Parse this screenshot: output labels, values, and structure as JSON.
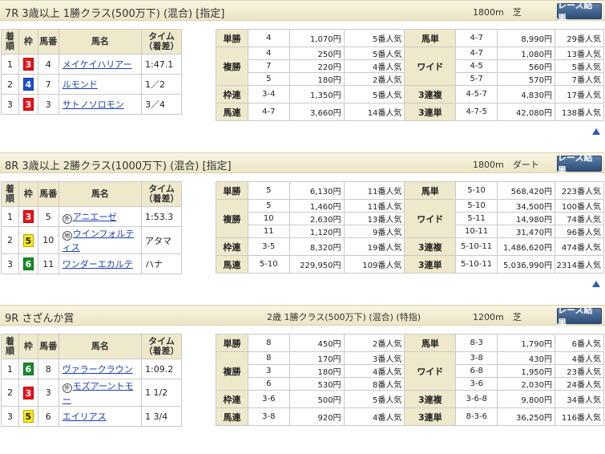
{
  "header_labels": {
    "finish_order": "着順",
    "frame": "枠",
    "horse_num": "馬番",
    "horse_name": "馬名",
    "time": "タイム（着差）",
    "result_button": "レース結果"
  },
  "colors": {
    "frame_3": "#e8141a",
    "frame_4": "#1a4fd6",
    "frame_5": "#f7e81a",
    "frame_6": "#1a8a2a",
    "header_band": "#ece5c4",
    "label_cell": "#efe9cc",
    "link": "#1a3fb0",
    "button": "#2d4d78"
  },
  "races": [
    {
      "title": "7R 3歳以上 1勝クラス(500万下) (混合) [指定]",
      "sub": "",
      "distance": "1800m　芝",
      "results": [
        {
          "pos": "1",
          "frame": "3",
          "num": "4",
          "mark": "",
          "name": "メイケイハリアー",
          "time": "1:47.1"
        },
        {
          "pos": "2",
          "frame": "4",
          "num": "7",
          "mark": "",
          "name": "ルモンド",
          "time": "1／2"
        },
        {
          "pos": "3",
          "frame": "3",
          "num": "3",
          "mark": "",
          "name": "サトノソロモン",
          "time": "3／4"
        }
      ],
      "payouts": {
        "tansho": {
          "label": "単勝",
          "combos": [
            "4"
          ],
          "amounts": [
            "1,070円"
          ],
          "pops": [
            "5番人気"
          ]
        },
        "fukusho": {
          "label": "複勝",
          "combos": [
            "4",
            "7",
            "5"
          ],
          "amounts": [
            "250円",
            "220円",
            "180円"
          ],
          "pops": [
            "5番人気",
            "4番人気",
            "2番人気"
          ]
        },
        "wakuren": {
          "label": "枠連",
          "combos": [
            "3-4"
          ],
          "amounts": [
            "1,350円"
          ],
          "pops": [
            "5番人気"
          ]
        },
        "umaren": {
          "label": "馬連",
          "combos": [
            "4-7"
          ],
          "amounts": [
            "3,660円"
          ],
          "pops": [
            "14番人気"
          ]
        },
        "umatan": {
          "label": "馬単",
          "combos": [
            "4-7"
          ],
          "amounts": [
            "8,990円"
          ],
          "pops": [
            "29番人気"
          ]
        },
        "wide": {
          "label": "ワイド",
          "combos": [
            "4-7",
            "4-5",
            "5-7"
          ],
          "amounts": [
            "1,080円",
            "560円",
            "570円"
          ],
          "pops": [
            "13番人気",
            "5番人気",
            "7番人気"
          ]
        },
        "sanrenpuku": {
          "label": "3連複",
          "combos": [
            "4-5-7"
          ],
          "amounts": [
            "4,830円"
          ],
          "pops": [
            "17番人気"
          ]
        },
        "sanrentan": {
          "label": "3連単",
          "combos": [
            "4-7-5"
          ],
          "amounts": [
            "42,080円"
          ],
          "pops": [
            "138番人気"
          ]
        }
      }
    },
    {
      "title": "8R 3歳以上 2勝クラス(1000万下) (混合) [指定]",
      "sub": "",
      "distance": "1800m　ダート",
      "results": [
        {
          "pos": "1",
          "frame": "3",
          "num": "5",
          "mark": "外",
          "name": "アニエーゼ",
          "time": "1:53.3"
        },
        {
          "pos": "2",
          "frame": "5",
          "num": "10",
          "mark": "地",
          "name": "ウインフォルティス",
          "time": "アタマ"
        },
        {
          "pos": "3",
          "frame": "6",
          "num": "11",
          "mark": "",
          "name": "ワンダーエカルテ",
          "time": "ハナ"
        }
      ],
      "payouts": {
        "tansho": {
          "label": "単勝",
          "combos": [
            "5"
          ],
          "amounts": [
            "6,130円"
          ],
          "pops": [
            "11番人気"
          ]
        },
        "fukusho": {
          "label": "複勝",
          "combos": [
            "5",
            "10",
            "11"
          ],
          "amounts": [
            "1,460円",
            "2,630円",
            "1,120円"
          ],
          "pops": [
            "11番人気",
            "13番人気",
            "9番人気"
          ]
        },
        "wakuren": {
          "label": "枠連",
          "combos": [
            "3-5"
          ],
          "amounts": [
            "8,320円"
          ],
          "pops": [
            "19番人気"
          ]
        },
        "umaren": {
          "label": "馬連",
          "combos": [
            "5-10"
          ],
          "amounts": [
            "229,950円"
          ],
          "pops": [
            "109番人気"
          ]
        },
        "umatan": {
          "label": "馬単",
          "combos": [
            "5-10"
          ],
          "amounts": [
            "568,420円"
          ],
          "pops": [
            "223番人気"
          ]
        },
        "wide": {
          "label": "ワイド",
          "combos": [
            "5-10",
            "5-11",
            "10-11"
          ],
          "amounts": [
            "34,500円",
            "14,980円",
            "31,470円"
          ],
          "pops": [
            "100番人気",
            "74番人気",
            "96番人気"
          ]
        },
        "sanrenpuku": {
          "label": "3連複",
          "combos": [
            "5-10-11"
          ],
          "amounts": [
            "1,486,620円"
          ],
          "pops": [
            "474番人気"
          ]
        },
        "sanrentan": {
          "label": "3連単",
          "combos": [
            "5-10-11"
          ],
          "amounts": [
            "5,036,990円"
          ],
          "pops": [
            "2314番人気"
          ]
        }
      }
    },
    {
      "title": "9R さざんか賞",
      "sub": "2歳 1勝クラス(500万下) (混合) (特指)",
      "distance": "1200m　芝",
      "results": [
        {
          "pos": "1",
          "frame": "6",
          "num": "8",
          "mark": "",
          "name": "ヴァラークラウン",
          "time": "1:09.2"
        },
        {
          "pos": "2",
          "frame": "3",
          "num": "3",
          "mark": "外",
          "name": "モズアーントモー",
          "time": "1 1/2"
        },
        {
          "pos": "3",
          "frame": "5",
          "num": "6",
          "mark": "",
          "name": "エイリアス",
          "time": "1 3/4"
        }
      ],
      "payouts": {
        "tansho": {
          "label": "単勝",
          "combos": [
            "8"
          ],
          "amounts": [
            "450円"
          ],
          "pops": [
            "2番人気"
          ]
        },
        "fukusho": {
          "label": "複勝",
          "combos": [
            "8",
            "3",
            "6"
          ],
          "amounts": [
            "170円",
            "180円",
            "530円"
          ],
          "pops": [
            "3番人気",
            "4番人気",
            "8番人気"
          ]
        },
        "wakuren": {
          "label": "枠連",
          "combos": [
            "3-6"
          ],
          "amounts": [
            "500円"
          ],
          "pops": [
            "5番人気"
          ]
        },
        "umaren": {
          "label": "馬連",
          "combos": [
            "3-8"
          ],
          "amounts": [
            "920円"
          ],
          "pops": [
            "4番人気"
          ]
        },
        "umatan": {
          "label": "馬単",
          "combos": [
            "8-3"
          ],
          "amounts": [
            "1,790円"
          ],
          "pops": [
            "6番人気"
          ]
        },
        "wide": {
          "label": "ワイド",
          "combos": [
            "3-8",
            "6-8",
            "3-6"
          ],
          "amounts": [
            "430円",
            "1,950円",
            "2,030円"
          ],
          "pops": [
            "4番人気",
            "23番人気",
            "24番人気"
          ]
        },
        "sanrenpuku": {
          "label": "3連複",
          "combos": [
            "3-6-8"
          ],
          "amounts": [
            "9,800円"
          ],
          "pops": [
            "34番人気"
          ]
        },
        "sanrentan": {
          "label": "3連単",
          "combos": [
            "8-3-6"
          ],
          "amounts": [
            "36,250円"
          ],
          "pops": [
            "116番人気"
          ]
        }
      }
    }
  ]
}
